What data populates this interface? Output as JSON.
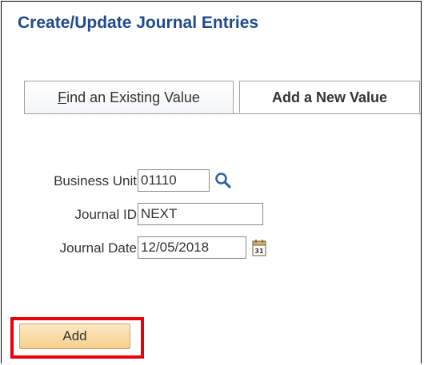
{
  "page": {
    "title": "Create/Update Journal Entries"
  },
  "tabs": [
    {
      "hotkey": "F",
      "rest": "ind an Existing Value",
      "active": false
    },
    {
      "label": "Add a New Value",
      "active": true
    }
  ],
  "form": {
    "business_unit": {
      "label": "Business Unit",
      "value": "01110"
    },
    "journal_id": {
      "label": "Journal ID",
      "value": "NEXT"
    },
    "journal_date": {
      "label": "Journal Date",
      "value": "12/05/2018"
    }
  },
  "icons": {
    "lookup": "magnifying-glass",
    "calendar": "calendar",
    "calendar_glyph": "31"
  },
  "actions": {
    "add_label": "Add"
  },
  "colors": {
    "title": "#1f4b8c",
    "highlight": "#e8000b",
    "button_top": "#fde9c4",
    "button_bottom": "#f6cf8c"
  }
}
